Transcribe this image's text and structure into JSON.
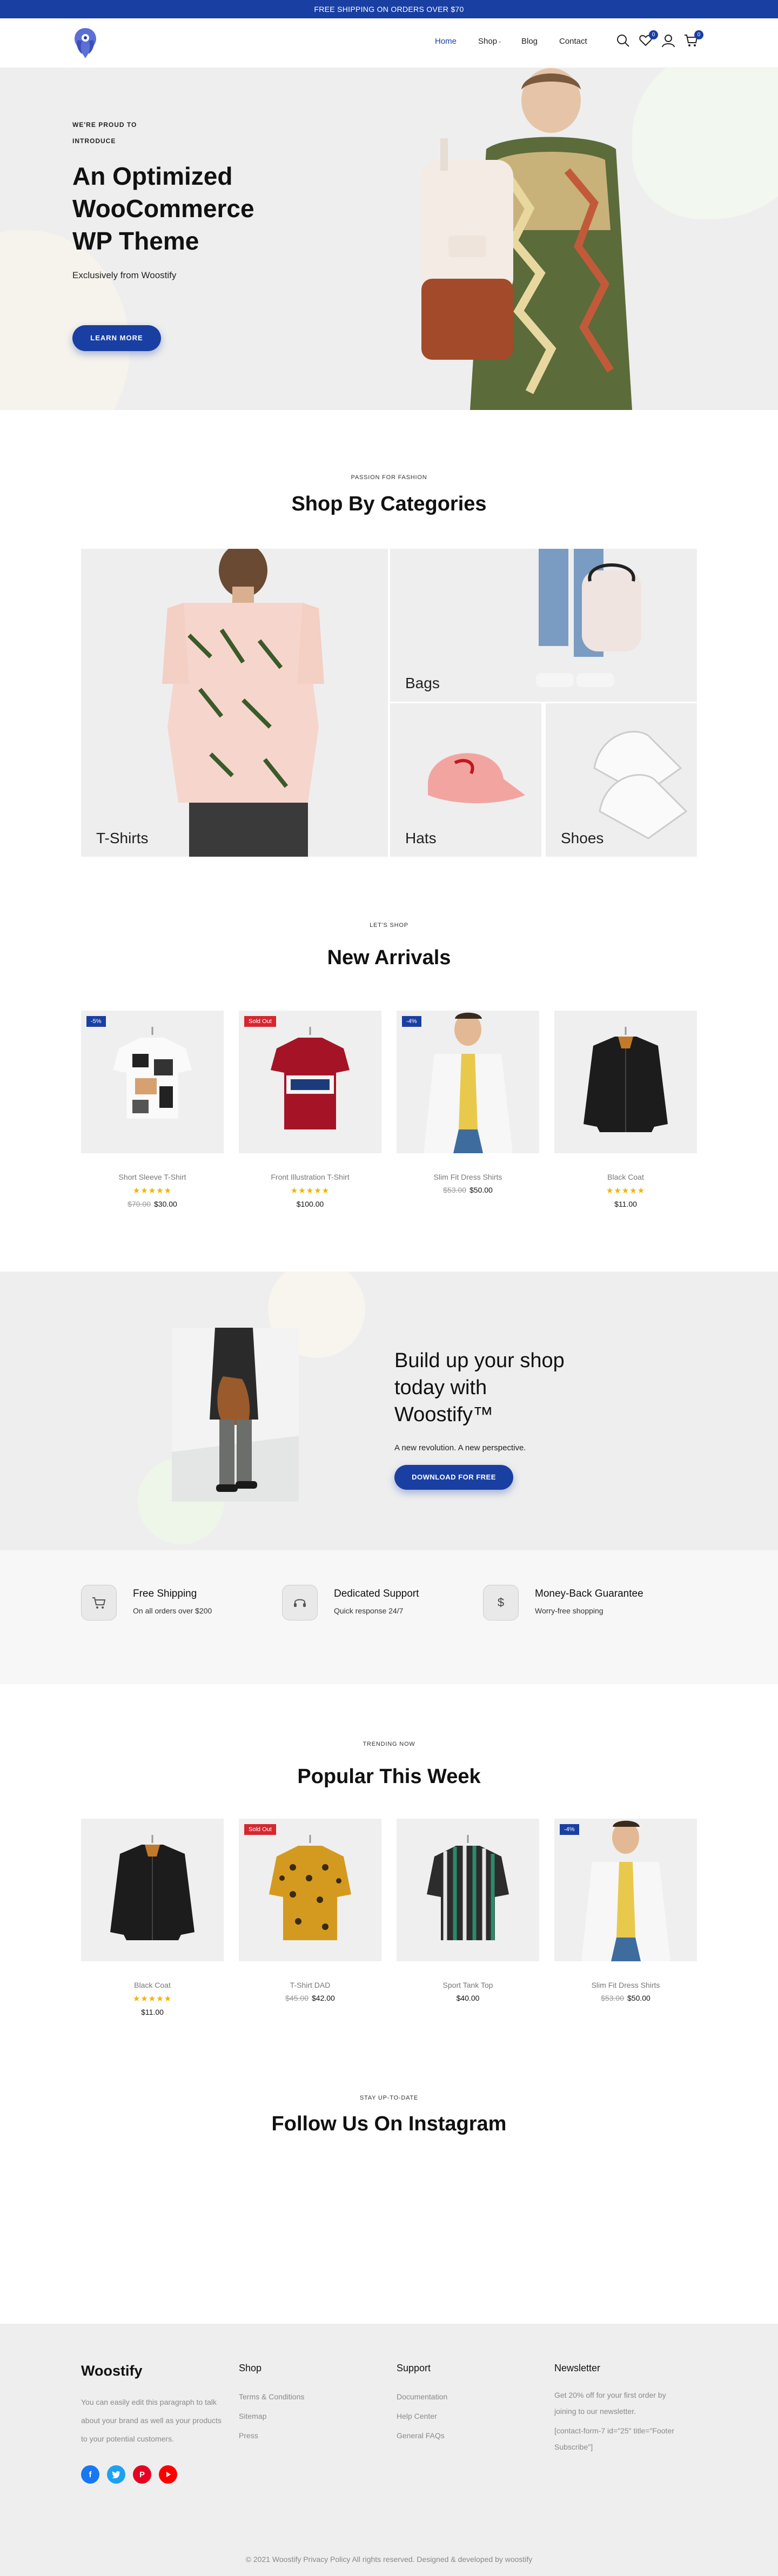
{
  "topbar": {
    "text": "FREE SHIPPING ON ORDERS OVER $70"
  },
  "nav": {
    "items": [
      {
        "label": "Home"
      },
      {
        "label": "Shop"
      },
      {
        "label": "Blog"
      },
      {
        "label": "Contact"
      }
    ],
    "wishlist_count": "0",
    "cart_count": "0"
  },
  "hero": {
    "eyebrow": "WE'RE PROUD TO INTRODUCE",
    "title": "An Optimized WooCommerce WP Theme",
    "subtitle": "Exclusively from Woostify",
    "button": "LEARN MORE"
  },
  "categories_section": {
    "eyebrow": "PASSION FOR FASHION",
    "title": "Shop By Categories",
    "items": [
      {
        "label": "T-Shirts"
      },
      {
        "label": "Bags"
      },
      {
        "label": "Hats"
      },
      {
        "label": "Shoes"
      }
    ]
  },
  "new_arrivals": {
    "eyebrow": "LET'S SHOP",
    "title": "New Arrivals",
    "products": [
      {
        "name": "Short Sleeve T-Shirt",
        "tag": "-5%",
        "old_price": "$70.00",
        "price": "$30.00",
        "stars": "★★★★★"
      },
      {
        "name": "Front Illustration T-Shirt",
        "tag": "Sold Out",
        "old_price": "",
        "price": "$100.00",
        "stars": "★★★★★"
      },
      {
        "name": "Slim Fit Dress Shirts",
        "tag": "-4%",
        "old_price": "$53.00",
        "price": "$50.00",
        "stars": ""
      },
      {
        "name": "Black Coat",
        "tag": "",
        "old_price": "",
        "price": "$11.00",
        "stars": "★★★★★"
      }
    ]
  },
  "promo": {
    "title": "Build up your shop today with Woostify™",
    "subtitle": "A new revolution. A new perspective.",
    "button": "DOWNLOAD FOR FREE"
  },
  "features": [
    {
      "title": "Free Shipping",
      "subtitle": "On all orders over $200",
      "icon": "cart-icon"
    },
    {
      "title": "Dedicated Support",
      "subtitle": "Quick response 24/7",
      "icon": "headset-icon"
    },
    {
      "title": "Money-Back Guarantee",
      "subtitle": "Worry-free shopping",
      "icon": "dollar-icon"
    }
  ],
  "popular": {
    "eyebrow": "TRENDING NOW",
    "title": "Popular This Week",
    "products": [
      {
        "name": "Black Coat",
        "tag": "",
        "old_price": "",
        "price": "$11.00",
        "stars": "★★★★★"
      },
      {
        "name": "T-Shirt DAD",
        "tag": "Sold Out",
        "old_price": "$45.00",
        "price": "$42.00",
        "stars": ""
      },
      {
        "name": "Sport Tank Top",
        "tag": "",
        "old_price": "",
        "price": "$40.00",
        "stars": ""
      },
      {
        "name": "Slim Fit Dress Shirts",
        "tag": "-4%",
        "old_price": "$53.00",
        "price": "$50.00",
        "stars": ""
      }
    ]
  },
  "instagram": {
    "eyebrow": "STAY UP-TO-DATE",
    "title": "Follow Us On Instagram"
  },
  "footer": {
    "brand": "Woostify",
    "about": "You can easily edit this paragraph to talk about your brand as well as your products to your potential customers.",
    "shop_title": "Shop",
    "shop_links": [
      "Terms & Conditions",
      "Sitemap",
      "Press"
    ],
    "support_title": "Support",
    "support_links": [
      "Documentation",
      "Help Center",
      "General FAQs"
    ],
    "newsletter_title": "Newsletter",
    "newsletter_text": "Get 20% off for your first order by joining to our newsletter.",
    "newsletter_shortcode": "[contact-form-7 id=\"25\" title=\"Footer Subscribe\"]",
    "copyright": "© 2021 Woostify Privacy Policy All rights reserved. Designed & developed by woostify"
  },
  "colors": {
    "accent": "#1a3fa3",
    "sale_tag": "#d7262f",
    "star": "#f0b400",
    "facebook": "#1877f2",
    "twitter": "#1da1f2",
    "pinterest": "#e60023",
    "youtube": "#ff0000"
  }
}
